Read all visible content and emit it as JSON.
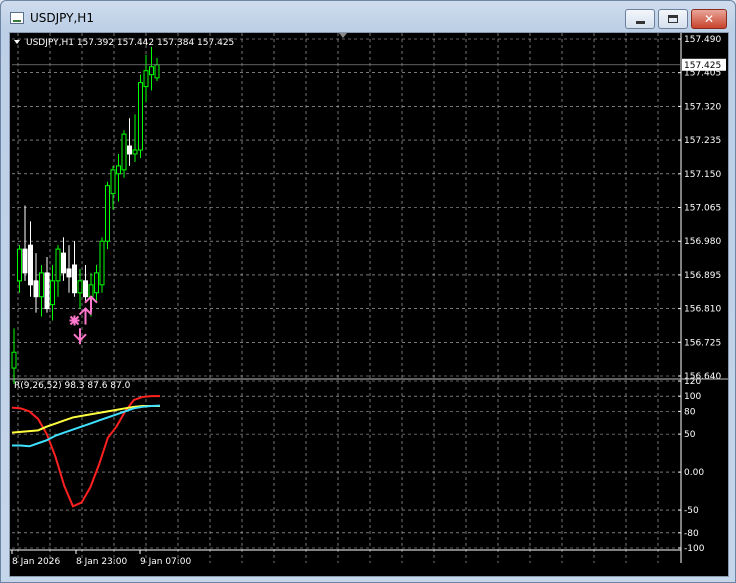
{
  "window": {
    "title": "USDJPY,H1",
    "buttons": {
      "minimize": "minimize",
      "maximize": "maximize",
      "close": "✕"
    }
  },
  "chart": {
    "info_label": "USDJPY,H1  157.392 157.442 157.384 157.425",
    "current_price_label": "157.425",
    "price_axis_labels": [
      "157.490",
      "157.405",
      "157.320",
      "157.235",
      "157.150",
      "157.065",
      "156.980",
      "156.895",
      "156.810",
      "156.725",
      "156.640"
    ],
    "time_axis_labels": [
      "8 Jan 2026",
      "8 Jan 23:00",
      "9 Jan 07:00"
    ],
    "colors": {
      "background": "#000000",
      "grid": "#c0c0c0",
      "bull": "#00ff00",
      "bear": "#ffffff",
      "arrow": "#ff77cc",
      "text": "#ffffff"
    }
  },
  "chart_data": [
    {
      "type": "candlestick",
      "symbol": "USDJPY",
      "timeframe": "H1",
      "ylim": [
        156.64,
        157.49
      ],
      "candles": [
        {
          "o": 156.66,
          "h": 156.76,
          "l": 156.62,
          "c": 156.7
        },
        {
          "o": 156.88,
          "h": 156.97,
          "l": 156.85,
          "c": 156.96
        },
        {
          "o": 156.96,
          "h": 157.07,
          "l": 156.88,
          "c": 156.9
        },
        {
          "o": 156.97,
          "h": 157.03,
          "l": 156.84,
          "c": 156.87
        },
        {
          "o": 156.88,
          "h": 156.95,
          "l": 156.8,
          "c": 156.84
        },
        {
          "o": 156.84,
          "h": 156.92,
          "l": 156.79,
          "c": 156.9
        },
        {
          "o": 156.9,
          "h": 156.94,
          "l": 156.8,
          "c": 156.81
        },
        {
          "o": 156.82,
          "h": 156.92,
          "l": 156.78,
          "c": 156.88
        },
        {
          "o": 156.88,
          "h": 156.97,
          "l": 156.84,
          "c": 156.96
        },
        {
          "o": 156.95,
          "h": 156.99,
          "l": 156.88,
          "c": 156.9
        },
        {
          "o": 156.91,
          "h": 156.97,
          "l": 156.85,
          "c": 156.89
        },
        {
          "o": 156.92,
          "h": 156.98,
          "l": 156.84,
          "c": 156.85
        },
        {
          "o": 156.85,
          "h": 156.91,
          "l": 156.81,
          "c": 156.88
        },
        {
          "o": 156.88,
          "h": 156.92,
          "l": 156.83,
          "c": 156.84
        },
        {
          "o": 156.84,
          "h": 156.9,
          "l": 156.79,
          "c": 156.87
        },
        {
          "o": 156.85,
          "h": 156.92,
          "l": 156.83,
          "c": 156.9
        },
        {
          "o": 156.87,
          "h": 156.99,
          "l": 156.85,
          "c": 156.98
        },
        {
          "o": 156.98,
          "h": 157.13,
          "l": 156.96,
          "c": 157.12
        },
        {
          "o": 157.1,
          "h": 157.17,
          "l": 157.06,
          "c": 157.16
        },
        {
          "o": 157.15,
          "h": 157.2,
          "l": 157.08,
          "c": 157.17
        },
        {
          "o": 157.16,
          "h": 157.26,
          "l": 157.14,
          "c": 157.25
        },
        {
          "o": 157.22,
          "h": 157.29,
          "l": 157.17,
          "c": 157.2
        },
        {
          "o": 157.2,
          "h": 157.3,
          "l": 157.18,
          "c": 157.21
        },
        {
          "o": 157.21,
          "h": 157.4,
          "l": 157.19,
          "c": 157.38
        },
        {
          "o": 157.37,
          "h": 157.45,
          "l": 157.33,
          "c": 157.41
        },
        {
          "o": 157.4,
          "h": 157.47,
          "l": 157.36,
          "c": 157.42
        },
        {
          "o": 157.392,
          "h": 157.442,
          "l": 157.384,
          "c": 157.425
        }
      ],
      "signals": [
        {
          "candle": 11,
          "kind": "star",
          "price": 156.78
        },
        {
          "candle": 12,
          "kind": "down_arrow",
          "price": 156.73
        },
        {
          "candle": 13,
          "kind": "up_arrow",
          "price": 156.8
        },
        {
          "candle": 14,
          "kind": "up_arrow",
          "price": 156.83
        }
      ]
    },
    {
      "type": "line",
      "title": "R(9,26,52) 98.3 87.6 87.0",
      "ylim": [
        -100,
        120
      ],
      "ticks": [
        "120",
        "100",
        "80",
        "50",
        "0.00",
        "-50",
        "-80",
        "-100"
      ],
      "series": [
        {
          "color": "#ff2020",
          "values": [
            85,
            84,
            80,
            70,
            50,
            20,
            -18,
            -45,
            -40,
            -20,
            10,
            45,
            60,
            80,
            95,
            99,
            100,
            100
          ]
        },
        {
          "color": "#ffff40",
          "values": [
            52,
            53,
            54,
            55,
            60,
            64,
            68,
            72,
            74,
            76,
            78,
            80,
            82,
            84,
            86,
            87,
            87,
            87
          ]
        },
        {
          "color": "#40e0ff",
          "values": [
            35,
            35,
            34,
            38,
            42,
            48,
            52,
            56,
            60,
            64,
            68,
            72,
            76,
            80,
            84,
            86,
            87,
            87.6
          ]
        }
      ]
    }
  ]
}
